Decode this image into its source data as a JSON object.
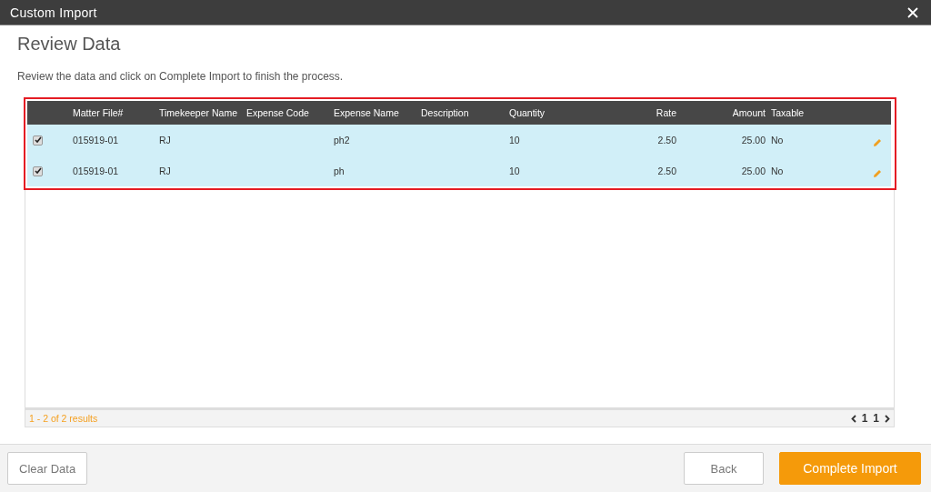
{
  "window": {
    "title": "Custom Import"
  },
  "heading": "Review Data",
  "instructions": "Review the data and click on Complete Import to finish the process.",
  "table": {
    "columns": [
      "Matter File#",
      "Timekeeper Name",
      "Expense Code",
      "Expense Name",
      "Description",
      "Quantity",
      "Rate",
      "Amount",
      "Taxable"
    ],
    "rows": [
      {
        "checked": true,
        "cells": [
          "015919-01",
          "RJ",
          "",
          "ph2",
          "",
          "10",
          "2.50",
          "25.00",
          "No"
        ]
      },
      {
        "checked": true,
        "cells": [
          "015919-01",
          "RJ",
          "",
          "ph",
          "",
          "10",
          "2.50",
          "25.00",
          "No"
        ]
      }
    ]
  },
  "pager": {
    "summary": "1 - 2 of 2 results",
    "current_page": "1",
    "page_count": "1"
  },
  "buttons": {
    "clear": "Clear Data",
    "back": "Back",
    "complete": "Complete Import"
  }
}
